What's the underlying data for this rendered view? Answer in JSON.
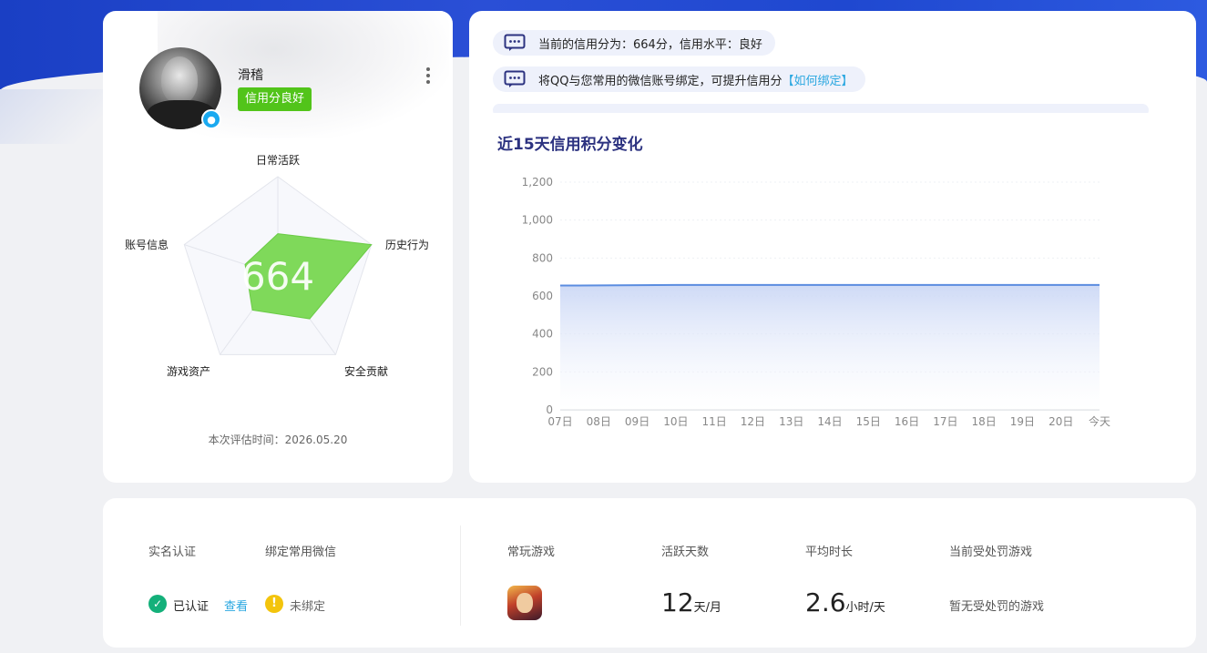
{
  "profile": {
    "nickname": "滑稽",
    "credit_tag": "信用分良好",
    "score": "664",
    "radar_labels": [
      "日常活跃",
      "历史行为",
      "安全贡献",
      "游戏资产",
      "账号信息"
    ],
    "radar_values": [
      0.42,
      1.0,
      0.55,
      0.44,
      0.35
    ],
    "eval_time_label": "本次评估时间：",
    "eval_time": "2026.05.20"
  },
  "tips": [
    {
      "text": "当前的信用分为：664分，信用水平：良好",
      "link": ""
    },
    {
      "text": "将QQ与您常用的微信账号绑定，可提升信用分",
      "link": "【如何绑定】"
    }
  ],
  "chart_title": "近15天信用积分变化",
  "chart_data": {
    "type": "area",
    "categories": [
      "07日",
      "08日",
      "09日",
      "10日",
      "11日",
      "12日",
      "13日",
      "14日",
      "15日",
      "16日",
      "17日",
      "18日",
      "19日",
      "20日",
      "今天"
    ],
    "series": [
      {
        "values": [
          655,
          656,
          657,
          658,
          658,
          658,
          658,
          658,
          658,
          658,
          658,
          658,
          658,
          658,
          658
        ]
      }
    ],
    "yticks": [
      "0",
      "200",
      "400",
      "600",
      "800",
      "1,000",
      "1,200"
    ],
    "ylim": [
      0,
      1200
    ],
    "color": "#5b8de0"
  },
  "stats": {
    "realname_head": "实名认证",
    "wechat_head": "绑定常用微信",
    "realname_status": "已认证",
    "realname_link": "查看",
    "wechat_status": "未绑定",
    "game_head": "常玩游戏",
    "active_head": "活跃天数",
    "active_value": "12",
    "active_unit": "天/月",
    "duration_head": "平均时长",
    "duration_value": "2.6",
    "duration_unit": "小时/天",
    "punish_head": "当前受处罚游戏",
    "punish_value": "暂无受处罚的游戏"
  }
}
